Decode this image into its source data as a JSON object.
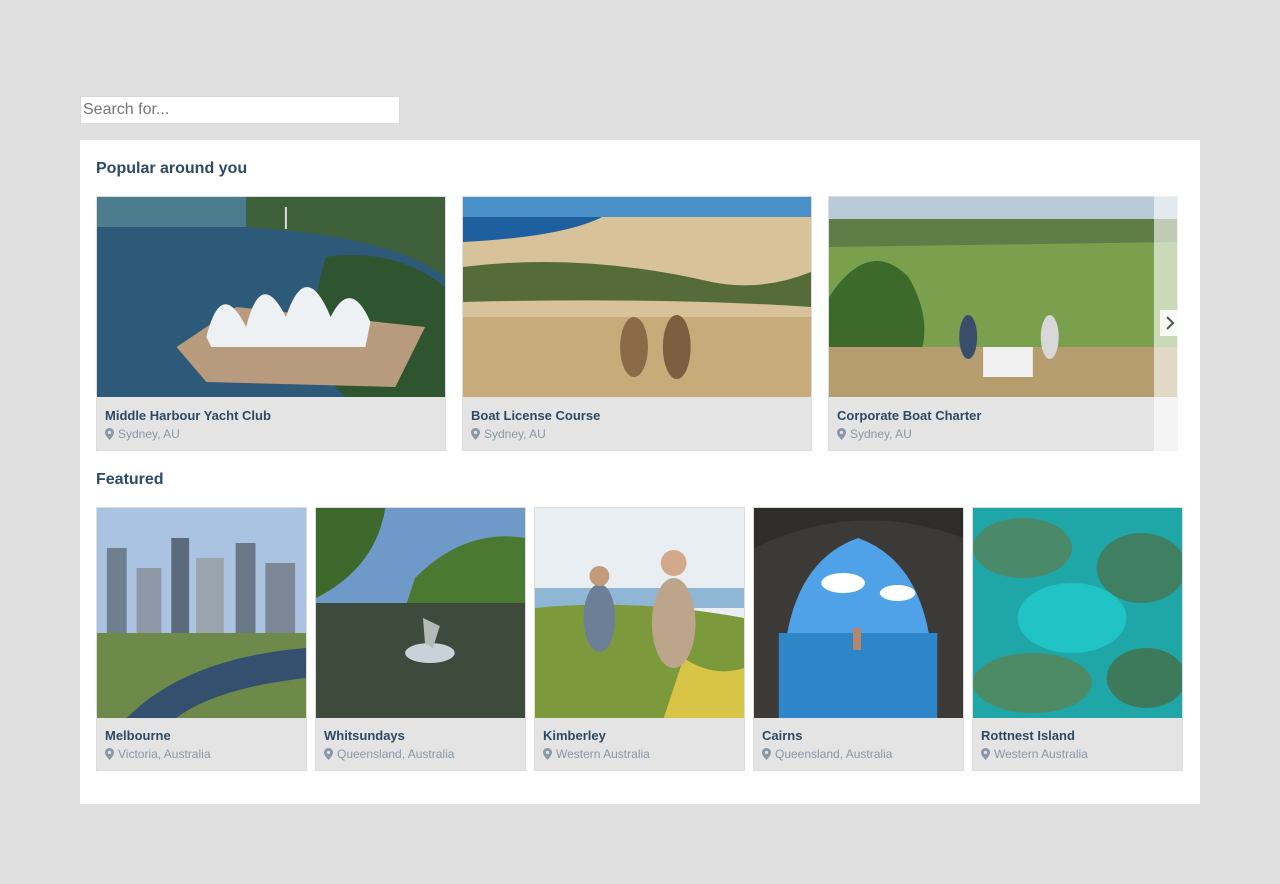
{
  "search": {
    "placeholder": "Search for..."
  },
  "sections": {
    "popular": {
      "title": "Popular around you",
      "cards": [
        {
          "name": "Middle Harbour Yacht Club",
          "location": "Sydney, AU"
        },
        {
          "name": "Boat License Course",
          "location": "Sydney, AU"
        },
        {
          "name": "Corporate Boat Charter",
          "location": "Sydney, AU"
        }
      ]
    },
    "featured": {
      "title": "Featured",
      "cards": [
        {
          "name": "Melbourne",
          "location": "Victoria, Australia"
        },
        {
          "name": "Whitsundays",
          "location": "Queensland, Australia"
        },
        {
          "name": "Kimberley",
          "location": "Western Australia"
        },
        {
          "name": "Cairns",
          "location": "Queensland, Australia"
        },
        {
          "name": "Rottnest Island",
          "location": "Western Australia"
        }
      ]
    }
  },
  "icons": {
    "pin": "map-pin-icon",
    "next": "chevron-right-icon"
  },
  "colors": {
    "title": "#2c4a66",
    "location": "#8a97a6",
    "card_bg": "#e4e4e4",
    "page_bg": "#e0e0e0"
  }
}
